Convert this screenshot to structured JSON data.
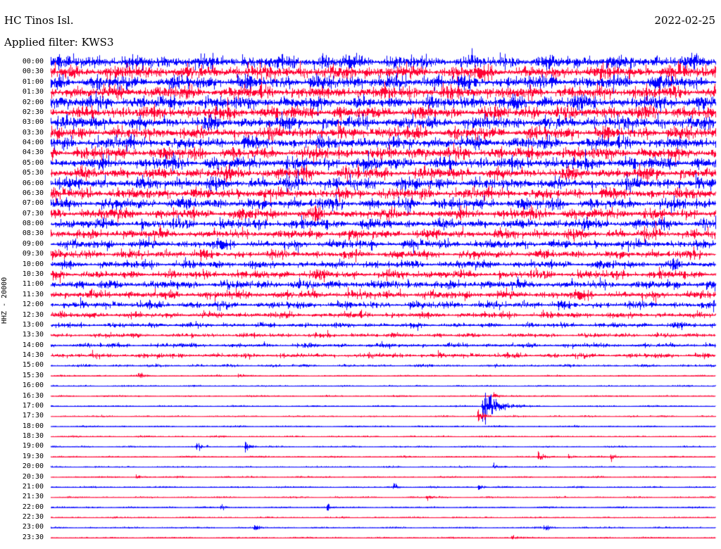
{
  "header": {
    "station": "HC Tinos Isl.",
    "filter": "Applied filter: KWS3",
    "date": "2022-02-25",
    "channel": "HHZ - 20000"
  },
  "colors": {
    "trace_a": "#0000ff",
    "trace_b": "#ff0033",
    "background": "#ffffff"
  },
  "time_labels": [
    "00:00",
    "00:30",
    "01:00",
    "01:30",
    "02:00",
    "02:30",
    "03:00",
    "03:30",
    "04:00",
    "04:30",
    "05:00",
    "05:30",
    "06:00",
    "06:30",
    "07:00",
    "07:30",
    "08:00",
    "08:30",
    "09:00",
    "09:30",
    "10:00",
    "10:30",
    "11:00",
    "11:30",
    "12:00",
    "12:30",
    "13:00",
    "13:30",
    "14:00",
    "14:30",
    "15:00",
    "15:30",
    "16:00",
    "16:30",
    "17:00",
    "17:30",
    "18:00",
    "18:30",
    "19:00",
    "19:30",
    "20:00",
    "20:30",
    "21:00",
    "21:30",
    "22:00",
    "22:30",
    "23:00",
    "23:30"
  ],
  "noise_level": [
    5.0,
    5.0,
    5.0,
    4.8,
    4.8,
    4.6,
    4.6,
    4.5,
    4.5,
    4.4,
    4.4,
    4.2,
    4.2,
    4.0,
    4.0,
    3.8,
    3.6,
    3.4,
    3.2,
    3.0,
    2.8,
    3.0,
    3.2,
    3.0,
    2.6,
    2.2,
    1.8,
    1.6,
    1.6,
    1.8,
    0.8,
    0.5,
    0.5,
    0.5,
    0.5,
    0.5,
    0.5,
    0.5,
    0.5,
    0.5,
    0.5,
    0.5,
    0.5,
    0.5,
    0.5,
    0.5,
    0.5,
    0.5
  ],
  "events": [
    {
      "row": 31,
      "minute": 4,
      "amp": 2.0
    },
    {
      "row": 31,
      "minute": 8.5,
      "amp": 1.5
    },
    {
      "row": 33,
      "minute": 20,
      "amp": 2.5
    },
    {
      "row": 34,
      "minute": 19.5,
      "amp": 14
    },
    {
      "row": 35,
      "minute": 19.3,
      "amp": 6
    },
    {
      "row": 38,
      "minute": 6.6,
      "amp": 3
    },
    {
      "row": 38,
      "minute": 8.8,
      "amp": 4
    },
    {
      "row": 39,
      "minute": 22,
      "amp": 4
    },
    {
      "row": 39,
      "minute": 23.4,
      "amp": 2
    },
    {
      "row": 39,
      "minute": 25.3,
      "amp": 3
    },
    {
      "row": 40,
      "minute": 20,
      "amp": 2
    },
    {
      "row": 41,
      "minute": 3.9,
      "amp": 1.5
    },
    {
      "row": 42,
      "minute": 15.5,
      "amp": 2.5
    },
    {
      "row": 42,
      "minute": 19.3,
      "amp": 3
    },
    {
      "row": 43,
      "minute": 17,
      "amp": 2.5
    },
    {
      "row": 44,
      "minute": 7.7,
      "amp": 3
    },
    {
      "row": 44,
      "minute": 12.5,
      "amp": 2.5
    },
    {
      "row": 46,
      "minute": 9.2,
      "amp": 2.5
    },
    {
      "row": 46,
      "minute": 22.3,
      "amp": 3
    },
    {
      "row": 47,
      "minute": 20.8,
      "amp": 1.5
    }
  ]
}
